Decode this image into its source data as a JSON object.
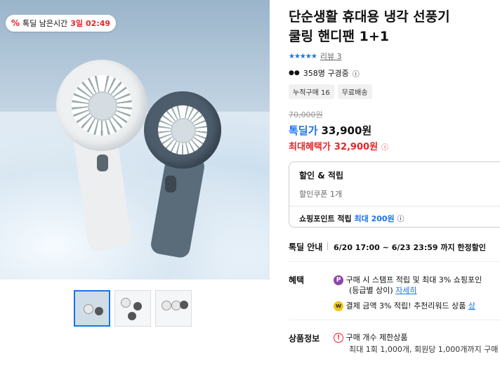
{
  "countdown": {
    "prefix": "%",
    "label": "톡딜 남은시간",
    "days": "3일",
    "time": "02:49"
  },
  "product": {
    "title_line1": "단순생활 휴대용 냉각 선풍기",
    "title_line2": "쿨링 핸디팬 1+1",
    "stars": "★★★★★",
    "review_link": "리뷰 3",
    "viewers": "358명 구경중",
    "tags": [
      "누적구매 16",
      "무료배송"
    ],
    "original_price": "70,000원",
    "deal_label": "톡딜가",
    "deal_price": "33,900원",
    "max_label": "최대혜택가",
    "max_price": "32,900원"
  },
  "benefits_box": {
    "title": "할인 & 적립",
    "coupon": "할인쿠폰 1개",
    "points_label": "쇼핑포인트 적립",
    "points_value": "최대 200원"
  },
  "deal_info": {
    "label": "톡딜 안내",
    "value": "6/20 17:00 ~ 6/23 23:59 까지 한정할인"
  },
  "benefits": {
    "label": "혜택",
    "line1": "구매 시 스탬프 적립 및 최대 3% 쇼핑포인",
    "line1b": "(등급별 상이)",
    "line1_link": "자세히",
    "line2": "결제 금액 3% 적립! 추천리워드 상품",
    "line2_link": "상"
  },
  "product_info": {
    "label": "상품정보",
    "line1": "구매 개수 제한상품",
    "line2": "최대 1회 1,000개, 회원당 1,000개까지 구매"
  },
  "colors": {
    "accent": "#1a73e8",
    "deal": "#e52528"
  }
}
